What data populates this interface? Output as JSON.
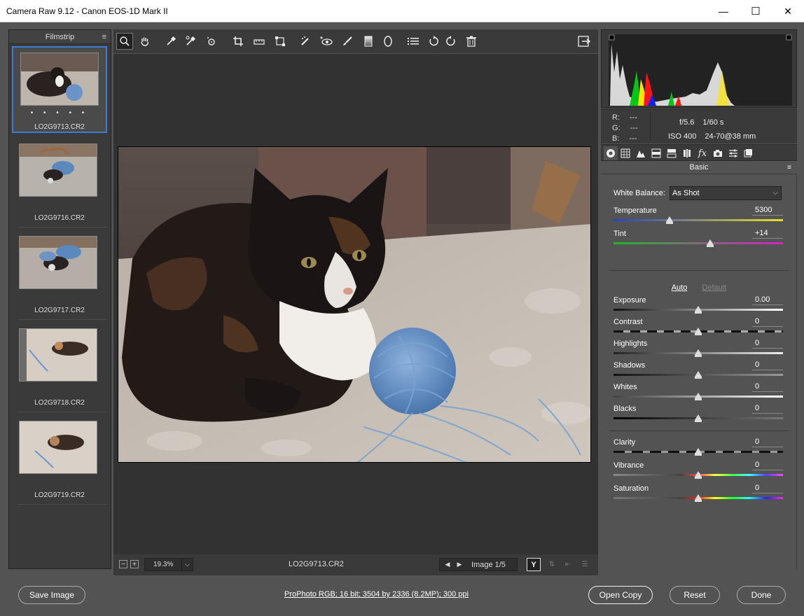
{
  "window": {
    "title": "Camera Raw 9.12  -  Canon EOS-1D Mark II",
    "minimize": "—",
    "maximize": "☐",
    "close": "✕"
  },
  "filmstrip": {
    "title": "Filmstrip",
    "menu_icon": "≡",
    "items": [
      {
        "label": "LO2G9713.CR2",
        "rating_dots": "• • • • •",
        "selected": true
      },
      {
        "label": "LO2G9716.CR2"
      },
      {
        "label": "LO2G9717.CR2"
      },
      {
        "label": "LO2G9718.CR2"
      },
      {
        "label": "LO2G9719.CR2"
      }
    ]
  },
  "toolbar": {
    "tools": [
      "zoom-icon",
      "hand-icon",
      "white-balance-icon",
      "color-sampler-icon",
      "targeted-adjustment-icon",
      "crop-icon",
      "straighten-icon",
      "transform-icon",
      "spot-removal-icon",
      "red-eye-icon",
      "adjustment-brush-icon",
      "graduated-filter-icon",
      "radial-filter-icon",
      "presets-list-icon",
      "rotate-ccw-icon",
      "rotate-cw-icon",
      "trash-icon"
    ],
    "export_icon": "open-in-photoshop-icon"
  },
  "status": {
    "zoom": "19.3%",
    "filename": "LO2G9713.CR2",
    "image_count": "Image 1/5",
    "y_toggle": "Y",
    "minus": "−",
    "plus": "+",
    "caret": "⌵"
  },
  "readout": {
    "r_label": "R:",
    "r_value": "---",
    "g_label": "G:",
    "g_value": "---",
    "b_label": "B:",
    "b_value": "---",
    "aperture": "f/5.6",
    "shutter": "1/60 s",
    "iso": "ISO 400",
    "lens": "24-70@38 mm"
  },
  "panel": {
    "title": "Basic",
    "menu_icon": "≡",
    "tabs": [
      "basic-icon",
      "tone-curve-icon",
      "detail-icon",
      "hsl-icon",
      "split-toning-icon",
      "lens-corrections-icon",
      "effects-icon",
      "camera-calibration-icon",
      "presets-icon",
      "snapshots-icon"
    ],
    "white_balance_label": "White Balance:",
    "white_balance_value": "As Shot",
    "auto": "Auto",
    "default": "Default",
    "sliders": {
      "temperature": {
        "label": "Temperature",
        "value": "5300",
        "pos": 0.33
      },
      "tint": {
        "label": "Tint",
        "value": "+14",
        "pos": 0.57
      },
      "exposure": {
        "label": "Exposure",
        "value": "0.00",
        "pos": 0.5
      },
      "contrast": {
        "label": "Contrast",
        "value": "0",
        "pos": 0.5
      },
      "highlights": {
        "label": "Highlights",
        "value": "0",
        "pos": 0.5
      },
      "shadows": {
        "label": "Shadows",
        "value": "0",
        "pos": 0.5
      },
      "whites": {
        "label": "Whites",
        "value": "0",
        "pos": 0.5
      },
      "blacks": {
        "label": "Blacks",
        "value": "0",
        "pos": 0.5
      },
      "clarity": {
        "label": "Clarity",
        "value": "0",
        "pos": 0.5
      },
      "vibrance": {
        "label": "Vibrance",
        "value": "0",
        "pos": 0.5
      },
      "saturation": {
        "label": "Saturation",
        "value": "0",
        "pos": 0.5
      }
    }
  },
  "bottom": {
    "save": "Save Image",
    "workflow": "ProPhoto RGB; 16 bit; 3504 by 2336 (8.2MP); 300 ppi",
    "open_copy": "Open Copy",
    "reset": "Reset",
    "done": "Done"
  },
  "colors": {
    "selection": "#3e7bd6",
    "panel_bg": "#535353",
    "dark_bg": "#3a3a3a",
    "canvas_bg": "#323232"
  }
}
